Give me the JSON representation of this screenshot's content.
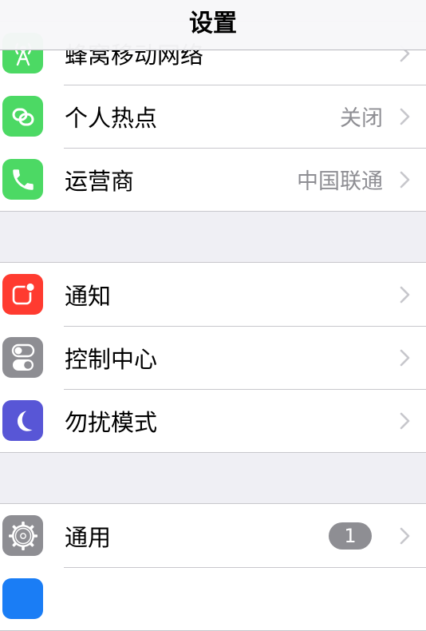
{
  "header": {
    "title": "设置"
  },
  "sections": [
    {
      "rows": [
        {
          "label": "蜂窝移动网络",
          "icon": "cellular-antenna-icon",
          "icon_color": "#4cd964"
        },
        {
          "label": "个人热点",
          "value": "关闭",
          "icon": "hotspot-chain-icon",
          "icon_color": "#4cd964"
        },
        {
          "label": "运营商",
          "value": "中国联通",
          "icon": "phone-icon",
          "icon_color": "#4cd964"
        }
      ]
    },
    {
      "rows": [
        {
          "label": "通知",
          "icon": "notifications-icon",
          "icon_color": "#ff3b30"
        },
        {
          "label": "控制中心",
          "icon": "control-center-toggles-icon",
          "icon_color": "#8e8e93"
        },
        {
          "label": "勿扰模式",
          "icon": "moon-icon",
          "icon_color": "#5856d6"
        }
      ]
    },
    {
      "rows": [
        {
          "label": "通用",
          "badge": "1",
          "icon": "gear-icon",
          "icon_color": "#8e8e93"
        }
      ]
    }
  ],
  "colors": {
    "background": "#efeff4",
    "separator": "#c8c7cc",
    "secondary_text": "#8e8e93",
    "chevron": "#c7c7cc",
    "badge": "#8e8e93",
    "partial_icon": "#1a7df5"
  }
}
